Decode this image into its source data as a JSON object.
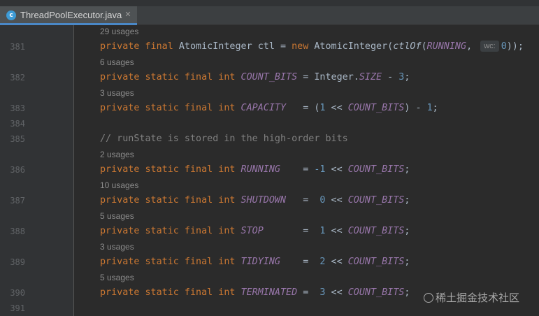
{
  "tab": {
    "filename": "ThreadPoolExecutor.java",
    "file_icon": "java-class-icon",
    "close_glyph": "✕"
  },
  "lines": [
    {
      "usage": "29 usages",
      "num": "381"
    },
    {
      "usage": "6 usages",
      "num": "382"
    },
    {
      "usage": "3 usages",
      "num": "383"
    },
    {
      "num": "384"
    },
    {
      "num": "385"
    },
    {
      "usage": "2 usages",
      "num": "386"
    },
    {
      "usage": "10 usages",
      "num": "387"
    },
    {
      "usage": "5 usages",
      "num": "388"
    },
    {
      "usage": "3 usages",
      "num": "389"
    },
    {
      "usage": "5 usages",
      "num": "390"
    },
    {
      "num": "391"
    }
  ],
  "code": {
    "l381": {
      "kw": "private final ",
      "type": "AtomicInteger ctl = ",
      "new": "new ",
      "cls": "AtomicInteger(",
      "call": "ctlOf",
      "paren": "(",
      "c": "RUNNING",
      "comma": ", ",
      "hint": "wc:",
      "zero": "0",
      "end": "));"
    },
    "l382": {
      "kw": "private static final int ",
      "c": "COUNT_BITS",
      "mid": " = Integer.",
      "c2": "SIZE",
      "minus": " - ",
      "n": "3",
      "end": ";"
    },
    "l383": {
      "kw": "private static final int ",
      "c": "CAPACITY",
      "mid": "   = (",
      "n1": "1",
      "shift": " << ",
      "c2": "COUNT_BITS",
      "minus": ") - ",
      "n2": "1",
      "end": ";"
    },
    "l385": {
      "cmt": "// runState is stored in the high-order bits"
    },
    "l386": {
      "kw": "private static final int ",
      "c": "RUNNING",
      "eq": "    = ",
      "n": "-1",
      "shift": " << ",
      "c2": "COUNT_BITS",
      "end": ";"
    },
    "l387": {
      "kw": "private static final int ",
      "c": "SHUTDOWN",
      "eq": "   =  ",
      "n": "0",
      "shift": " << ",
      "c2": "COUNT_BITS",
      "end": ";"
    },
    "l388": {
      "kw": "private static final int ",
      "c": "STOP",
      "eq": "       =  ",
      "n": "1",
      "shift": " << ",
      "c2": "COUNT_BITS",
      "end": ";"
    },
    "l389": {
      "kw": "private static final int ",
      "c": "TIDYING",
      "eq": "    =  ",
      "n": "2",
      "shift": " << ",
      "c2": "COUNT_BITS",
      "end": ";"
    },
    "l390": {
      "kw": "private static final int ",
      "c": "TERMINATED",
      "eq": " =  ",
      "n": "3",
      "shift": " << ",
      "c2": "COUNT_BITS",
      "end": ";"
    }
  },
  "watermark": "稀土掘金技术社区",
  "colors": {
    "keyword": "#cc7832",
    "constant": "#9876aa",
    "number": "#6897bb",
    "comment": "#808080",
    "text": "#a9b7c6",
    "background": "#2b2b2b"
  }
}
